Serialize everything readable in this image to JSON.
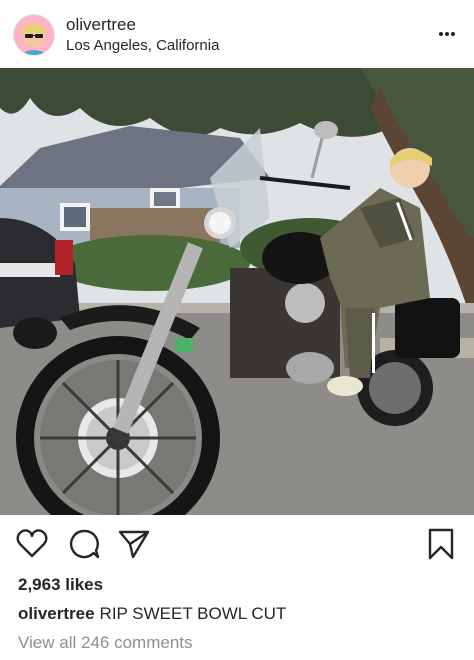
{
  "post": {
    "username": "olivertree",
    "location": "Los Angeles, California",
    "likes": "2,963 likes",
    "caption_user": "olivertree",
    "caption_text": "RIP SWEET BOWL CUT",
    "view_comments": "View all 246 comments"
  },
  "icons": {
    "more": "more-options-icon",
    "like": "heart-icon",
    "comment": "comment-bubble-icon",
    "share": "paper-plane-icon",
    "save": "bookmark-icon"
  },
  "colors": {
    "text": "#262626",
    "muted": "#8e8e8e",
    "background": "#ffffff"
  }
}
